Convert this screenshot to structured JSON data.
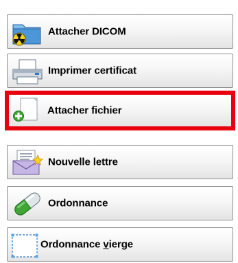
{
  "buttons": [
    {
      "id": "attach-dicom",
      "label": "Attacher DICOM",
      "icon": "dicom-folder-icon"
    },
    {
      "id": "print-certificate",
      "label": "Imprimer certificat",
      "icon": "printer-icon"
    },
    {
      "id": "attach-file",
      "label": "Attacher fichier",
      "icon": "add-file-icon",
      "selected": true
    },
    {
      "id": "new-letter",
      "label": "Nouvelle lettre",
      "icon": "new-letter-icon"
    },
    {
      "id": "prescription",
      "label": "Ordonnance",
      "icon": "pill-capsule-icon"
    },
    {
      "id": "blank-prescription",
      "label_prefix": "Ordonnance ",
      "label_mnemonic": "v",
      "label_suffix": "ierge",
      "icon": "blank-page-icon"
    }
  ],
  "colors": {
    "selection_border": "#e8000e",
    "button_border": "#8e8f91",
    "pill_green": "#3fa535"
  }
}
